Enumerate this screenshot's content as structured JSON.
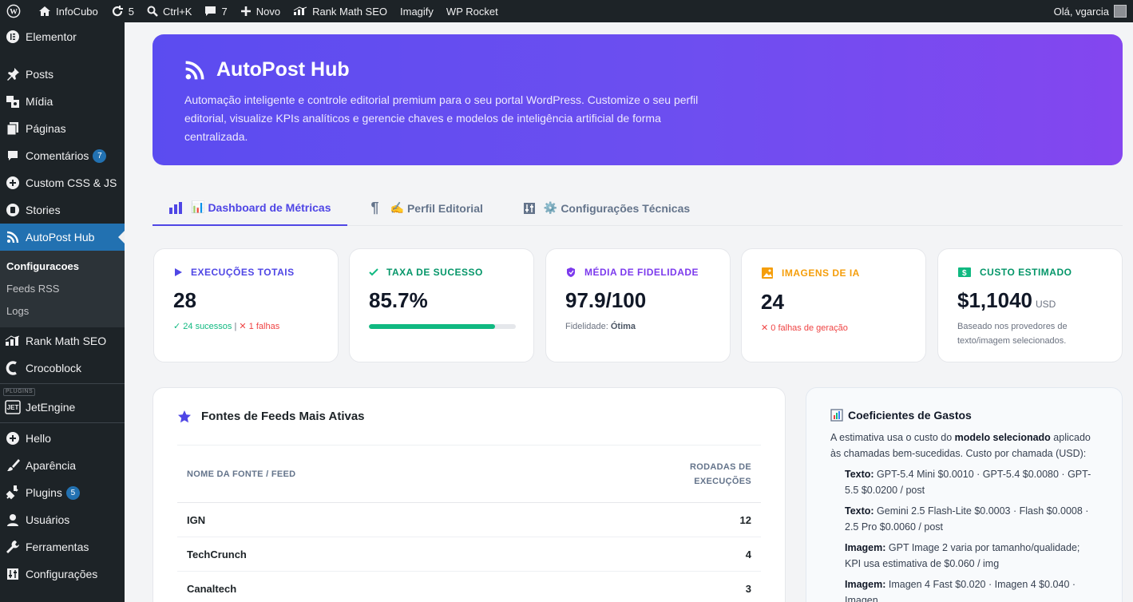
{
  "adminbar": {
    "site": "InfoCubo",
    "updates": "5",
    "search": "Ctrl+K",
    "comments": "7",
    "new": "Novo",
    "rankmath": "Rank Math SEO",
    "imagify": "Imagify",
    "wprocket": "WP Rocket",
    "greeting": "Olá, vgarcia"
  },
  "sidebar": {
    "items": [
      {
        "label": "Elementor",
        "icon": "elementor-icon"
      },
      {
        "label": "Posts",
        "icon": "pin-icon"
      },
      {
        "label": "Mídia",
        "icon": "media-icon"
      },
      {
        "label": "Páginas",
        "icon": "pages-icon"
      },
      {
        "label": "Comentários",
        "icon": "comment-icon",
        "badge": "7"
      },
      {
        "label": "Custom CSS & JS",
        "icon": "plus-circle-icon"
      },
      {
        "label": "Stories",
        "icon": "stories-icon"
      },
      {
        "label": "AutoPost Hub",
        "icon": "rss-icon"
      },
      {
        "label": "Rank Math SEO",
        "icon": "chart-icon"
      },
      {
        "label": "Crocoblock",
        "icon": "crocoblock-icon"
      },
      {
        "label": "JetEngine",
        "icon": "jet-icon"
      },
      {
        "label": "Hello",
        "icon": "plus-circle-icon"
      },
      {
        "label": "Aparência",
        "icon": "brush-icon"
      },
      {
        "label": "Plugins",
        "icon": "plug-icon",
        "badge": "5"
      },
      {
        "label": "Usuários",
        "icon": "user-icon"
      },
      {
        "label": "Ferramentas",
        "icon": "wrench-icon"
      },
      {
        "label": "Configurações",
        "icon": "sliders-icon"
      }
    ],
    "submenu": [
      "Configuracoes",
      "Feeds RSS",
      "Logs"
    ],
    "plugins_tag": "PLUGINS"
  },
  "hero": {
    "title": "AutoPost Hub",
    "description": "Automação inteligente e controle editorial premium para o seu portal WordPress. Customize o seu perfil editorial, visualize KPIs analíticos e gerencie chaves e modelos de inteligência artificial de forma centralizada."
  },
  "tabs": [
    {
      "emoji": "📊",
      "label": "Dashboard de Métricas"
    },
    {
      "emoji": "✍️",
      "label": "Perfil Editorial"
    },
    {
      "emoji": "⚙️",
      "label": "Configurações Técnicas"
    }
  ],
  "kpis": [
    {
      "label": "EXECUÇÕES TOTAIS",
      "value": "28",
      "note_ok": "✓ 24 sucessos",
      "note_sep": " | ",
      "note_fail": "✕ 1 falhas",
      "color": "#4f46e5"
    },
    {
      "label": "TAXA DE SUCESSO",
      "value": "85.7%",
      "progress": 0.857,
      "color": "#10b981"
    },
    {
      "label": "MÉDIA DE FIDELIDADE",
      "value": "97.9/100",
      "note_prefix": "Fidelidade: ",
      "note_strong": "Ótima",
      "color": "#7c3aed"
    },
    {
      "label": "IMAGENS DE IA",
      "value": "24",
      "note_fail": "✕ 0 falhas de geração",
      "color": "#f59e0b"
    },
    {
      "label": "CUSTO ESTIMADO",
      "value": "$1,1040",
      "unit": "USD",
      "note": "Baseado nos provedores de texto/imagem selecionados.",
      "color": "#10b981"
    }
  ],
  "feeds": {
    "title": "Fontes de Feeds Mais Ativas",
    "col_name": "NOME DA FONTE / FEED",
    "col_runs_1": "RODADAS DE",
    "col_runs_2": "EXECUÇÕES",
    "rows": [
      {
        "name": "IGN",
        "runs": "12"
      },
      {
        "name": "TechCrunch",
        "runs": "4"
      },
      {
        "name": "Canaltech",
        "runs": "3"
      }
    ]
  },
  "costs": {
    "title": "Coeficientes de Gastos",
    "intro_a": "A estimativa usa o custo do ",
    "intro_b": "modelo selecionado",
    "intro_c": " aplicado às chamadas bem-sucedidas. Custo por chamada (USD):",
    "items": [
      {
        "k": "Texto:",
        "v": " GPT-5.4 Mini $0.0010 · GPT-5.4 $0.0080 · GPT-5.5 $0.0200 / post"
      },
      {
        "k": "Texto:",
        "v": " Gemini 2.5 Flash-Lite $0.0003 · Flash $0.0008 · 2.5 Pro $0.0060 / post"
      },
      {
        "k": "Imagem:",
        "v": " GPT Image 2 varia por tamanho/qualidade; KPI usa estimativa de $0.060 / img"
      },
      {
        "k": "Imagem:",
        "v": " Imagen 4 Fast $0.020 · Imagen 4 $0.040 · Imagen"
      }
    ]
  }
}
